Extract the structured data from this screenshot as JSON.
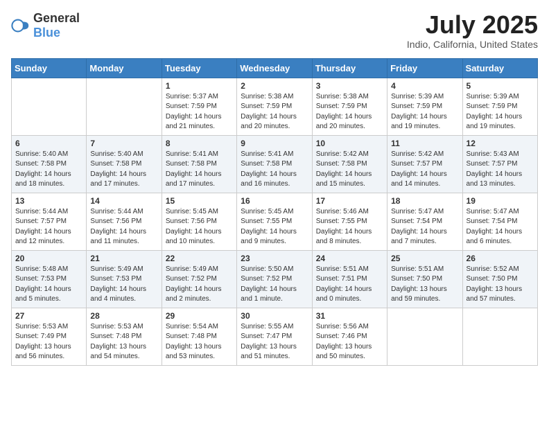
{
  "header": {
    "logo_general": "General",
    "logo_blue": "Blue",
    "month": "July 2025",
    "location": "Indio, California, United States"
  },
  "weekdays": [
    "Sunday",
    "Monday",
    "Tuesday",
    "Wednesday",
    "Thursday",
    "Friday",
    "Saturday"
  ],
  "weeks": [
    [
      null,
      null,
      {
        "day": 1,
        "sunrise": "5:37 AM",
        "sunset": "7:59 PM",
        "daylight": "14 hours and 21 minutes."
      },
      {
        "day": 2,
        "sunrise": "5:38 AM",
        "sunset": "7:59 PM",
        "daylight": "14 hours and 20 minutes."
      },
      {
        "day": 3,
        "sunrise": "5:38 AM",
        "sunset": "7:59 PM",
        "daylight": "14 hours and 20 minutes."
      },
      {
        "day": 4,
        "sunrise": "5:39 AM",
        "sunset": "7:59 PM",
        "daylight": "14 hours and 19 minutes."
      },
      {
        "day": 5,
        "sunrise": "5:39 AM",
        "sunset": "7:59 PM",
        "daylight": "14 hours and 19 minutes."
      }
    ],
    [
      {
        "day": 6,
        "sunrise": "5:40 AM",
        "sunset": "7:58 PM",
        "daylight": "14 hours and 18 minutes."
      },
      {
        "day": 7,
        "sunrise": "5:40 AM",
        "sunset": "7:58 PM",
        "daylight": "14 hours and 17 minutes."
      },
      {
        "day": 8,
        "sunrise": "5:41 AM",
        "sunset": "7:58 PM",
        "daylight": "14 hours and 17 minutes."
      },
      {
        "day": 9,
        "sunrise": "5:41 AM",
        "sunset": "7:58 PM",
        "daylight": "14 hours and 16 minutes."
      },
      {
        "day": 10,
        "sunrise": "5:42 AM",
        "sunset": "7:58 PM",
        "daylight": "14 hours and 15 minutes."
      },
      {
        "day": 11,
        "sunrise": "5:42 AM",
        "sunset": "7:57 PM",
        "daylight": "14 hours and 14 minutes."
      },
      {
        "day": 12,
        "sunrise": "5:43 AM",
        "sunset": "7:57 PM",
        "daylight": "14 hours and 13 minutes."
      }
    ],
    [
      {
        "day": 13,
        "sunrise": "5:44 AM",
        "sunset": "7:57 PM",
        "daylight": "14 hours and 12 minutes."
      },
      {
        "day": 14,
        "sunrise": "5:44 AM",
        "sunset": "7:56 PM",
        "daylight": "14 hours and 11 minutes."
      },
      {
        "day": 15,
        "sunrise": "5:45 AM",
        "sunset": "7:56 PM",
        "daylight": "14 hours and 10 minutes."
      },
      {
        "day": 16,
        "sunrise": "5:45 AM",
        "sunset": "7:55 PM",
        "daylight": "14 hours and 9 minutes."
      },
      {
        "day": 17,
        "sunrise": "5:46 AM",
        "sunset": "7:55 PM",
        "daylight": "14 hours and 8 minutes."
      },
      {
        "day": 18,
        "sunrise": "5:47 AM",
        "sunset": "7:54 PM",
        "daylight": "14 hours and 7 minutes."
      },
      {
        "day": 19,
        "sunrise": "5:47 AM",
        "sunset": "7:54 PM",
        "daylight": "14 hours and 6 minutes."
      }
    ],
    [
      {
        "day": 20,
        "sunrise": "5:48 AM",
        "sunset": "7:53 PM",
        "daylight": "14 hours and 5 minutes."
      },
      {
        "day": 21,
        "sunrise": "5:49 AM",
        "sunset": "7:53 PM",
        "daylight": "14 hours and 4 minutes."
      },
      {
        "day": 22,
        "sunrise": "5:49 AM",
        "sunset": "7:52 PM",
        "daylight": "14 hours and 2 minutes."
      },
      {
        "day": 23,
        "sunrise": "5:50 AM",
        "sunset": "7:52 PM",
        "daylight": "14 hours and 1 minute."
      },
      {
        "day": 24,
        "sunrise": "5:51 AM",
        "sunset": "7:51 PM",
        "daylight": "14 hours and 0 minutes."
      },
      {
        "day": 25,
        "sunrise": "5:51 AM",
        "sunset": "7:50 PM",
        "daylight": "13 hours and 59 minutes."
      },
      {
        "day": 26,
        "sunrise": "5:52 AM",
        "sunset": "7:50 PM",
        "daylight": "13 hours and 57 minutes."
      }
    ],
    [
      {
        "day": 27,
        "sunrise": "5:53 AM",
        "sunset": "7:49 PM",
        "daylight": "13 hours and 56 minutes."
      },
      {
        "day": 28,
        "sunrise": "5:53 AM",
        "sunset": "7:48 PM",
        "daylight": "13 hours and 54 minutes."
      },
      {
        "day": 29,
        "sunrise": "5:54 AM",
        "sunset": "7:48 PM",
        "daylight": "13 hours and 53 minutes."
      },
      {
        "day": 30,
        "sunrise": "5:55 AM",
        "sunset": "7:47 PM",
        "daylight": "13 hours and 51 minutes."
      },
      {
        "day": 31,
        "sunrise": "5:56 AM",
        "sunset": "7:46 PM",
        "daylight": "13 hours and 50 minutes."
      },
      null,
      null
    ]
  ]
}
